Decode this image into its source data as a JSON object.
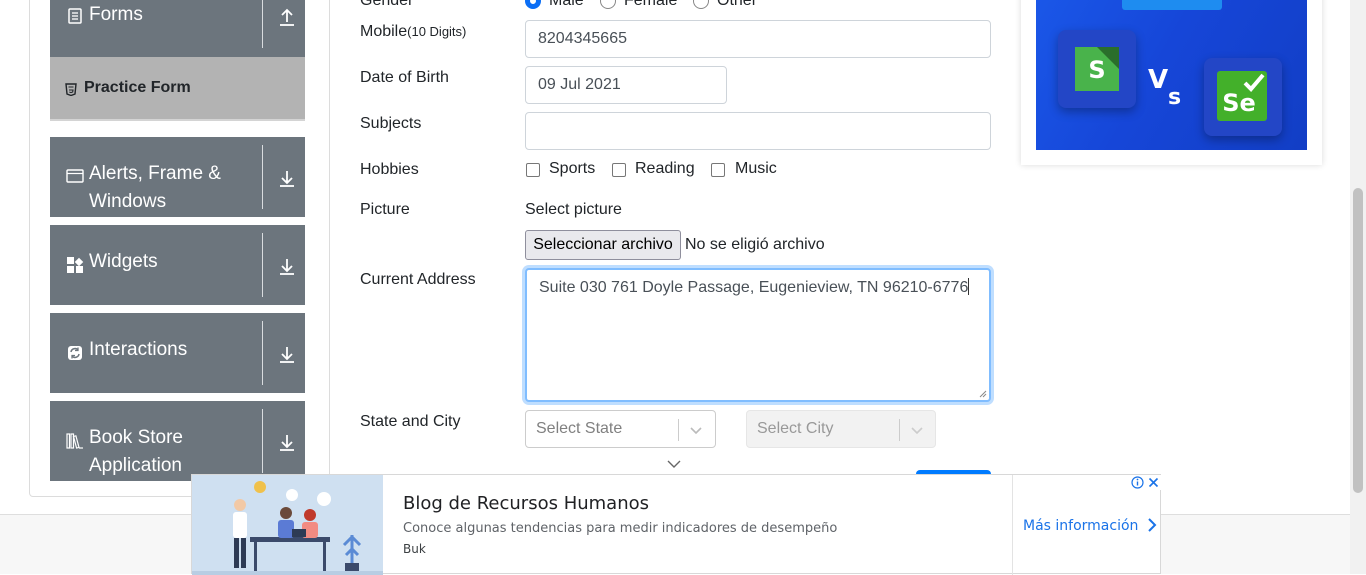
{
  "sidebar": {
    "groups": [
      {
        "label": "Forms"
      },
      {
        "label_line1": "Alerts, Frame &",
        "label_line2": "Windows"
      },
      {
        "label": "Widgets"
      },
      {
        "label": "Interactions"
      },
      {
        "label_line1": "Book Store",
        "label_line2": "Application"
      }
    ],
    "active_item": "Practice Form"
  },
  "form": {
    "gender": {
      "label": "Gender",
      "options": [
        "Male",
        "Female",
        "Other"
      ],
      "selected": "Male"
    },
    "mobile": {
      "label": "Mobile",
      "hint": "(10 Digits)",
      "value": "8204345665"
    },
    "dob": {
      "label": "Date of Birth",
      "value": "09 Jul 2021"
    },
    "subjects": {
      "label": "Subjects",
      "value": ""
    },
    "hobbies": {
      "label": "Hobbies",
      "options": [
        "Sports",
        "Reading",
        "Music"
      ]
    },
    "picture": {
      "label": "Picture",
      "select_text": "Select picture",
      "button": "Seleccionar archivo",
      "status": "No se eligió archivo"
    },
    "address": {
      "label": "Current Address",
      "value": "Suite 030 761 Doyle Passage, Eugenieview, TN 96210-6776"
    },
    "state_city": {
      "label": "State and City",
      "state_placeholder": "Select State",
      "city_placeholder": "Select City"
    }
  },
  "bottom_ad": {
    "title": "Blog de Recursos Humanos",
    "description": "Conoce algunas tendencias para medir indicadores de desempeño",
    "brand": "Buk",
    "cta": "Más información"
  },
  "colors": {
    "sidebar": "#6c757d",
    "active": "#b3b3b3",
    "accent": "#0b6ef5",
    "ad_blue": "#1646d8"
  }
}
